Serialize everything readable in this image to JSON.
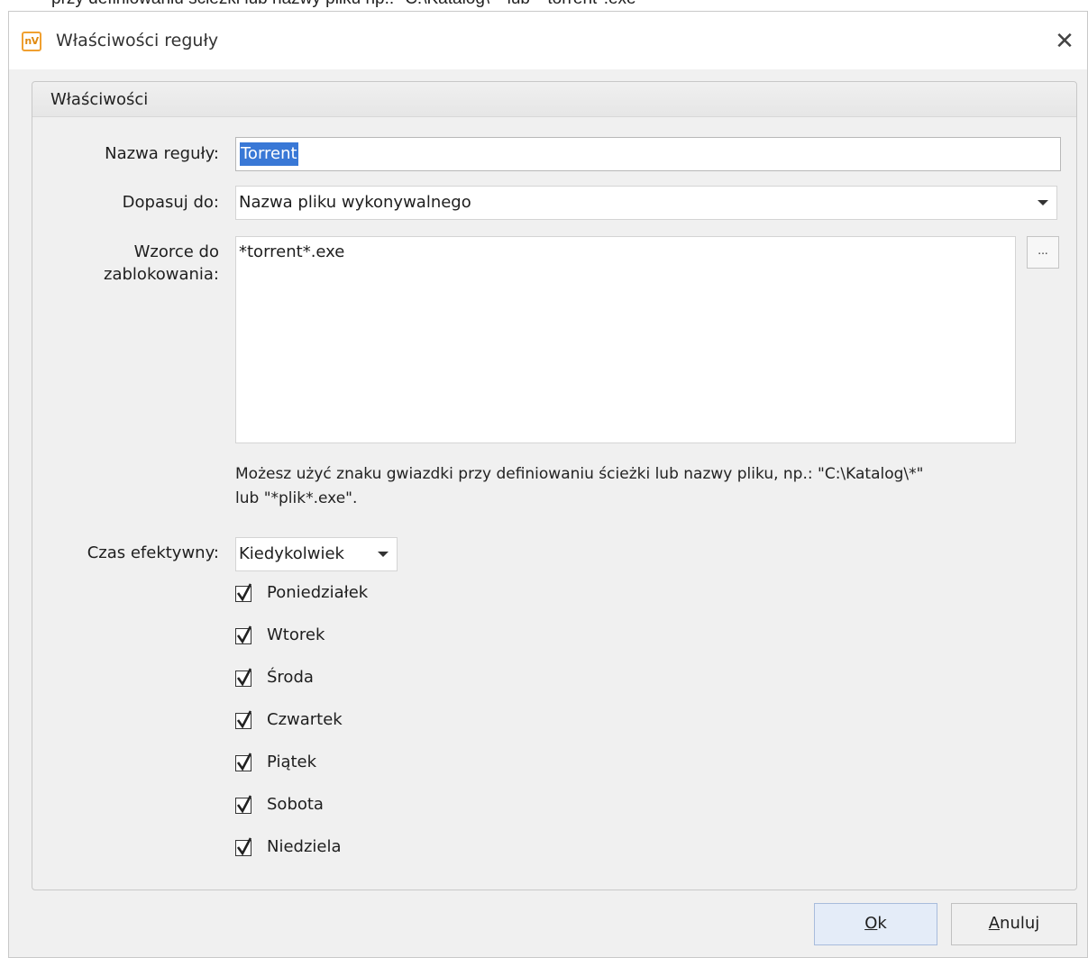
{
  "background_text": "przy definiowaniu ścieżki lub nazwy pliku np.: \"C:\\Katalog\\*\" lub \"*torrent*.exe\"",
  "dialog": {
    "app_icon_text": "nV",
    "title": "Właściwości reguły",
    "close_glyph": "✕"
  },
  "group": {
    "title": "Właściwości"
  },
  "form": {
    "rule_name_label": "Nazwa reguły:",
    "rule_name_value": "Torrent",
    "match_label": "Dopasuj do:",
    "match_value": "Nazwa pliku wykonywalnego",
    "patterns_label_line1": "Wzorce do",
    "patterns_label_line2": "zablokowania:",
    "patterns_value": "*torrent*.exe",
    "browse_label": "...",
    "hint_line1": "Możesz użyć znaku gwiazdki przy definiowaniu ścieżki lub nazwy pliku, np.: \"C:\\Katalog\\*\"",
    "hint_line2": "lub \"*plik*.exe\".",
    "time_label": "Czas efektywny:",
    "time_value": "Kiedykolwiek"
  },
  "days": [
    {
      "label": "Poniedziałek",
      "checked": true
    },
    {
      "label": "Wtorek",
      "checked": true
    },
    {
      "label": "Środa",
      "checked": true
    },
    {
      "label": "Czwartek",
      "checked": true
    },
    {
      "label": "Piątek",
      "checked": true
    },
    {
      "label": "Sobota",
      "checked": true
    },
    {
      "label": "Niedziela",
      "checked": true
    }
  ],
  "buttons": {
    "ok_mnemonic": "O",
    "ok_rest": "k",
    "cancel_mnemonic": "A",
    "cancel_rest": "nuluj"
  },
  "colors": {
    "selection": "#3978d6",
    "ok_button": "#e4ecf8",
    "app_icon": "#f0a030"
  }
}
